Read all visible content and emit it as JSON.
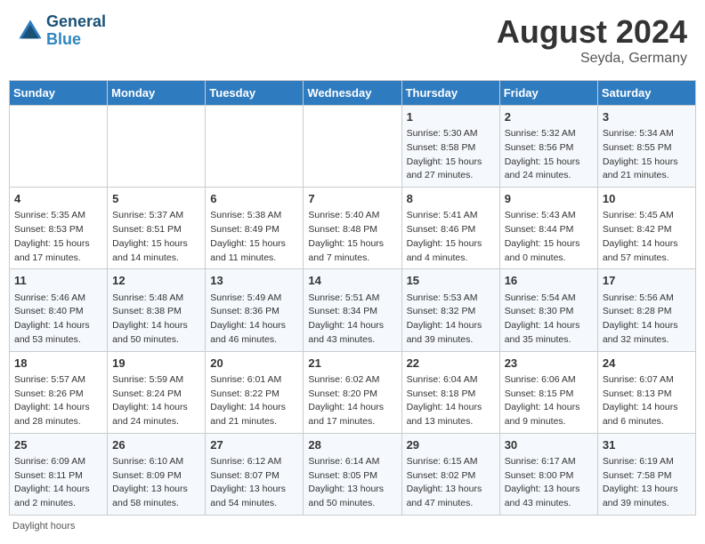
{
  "header": {
    "logo_line1": "General",
    "logo_line2": "Blue",
    "month_year": "August 2024",
    "location": "Seyda, Germany"
  },
  "days_of_week": [
    "Sunday",
    "Monday",
    "Tuesday",
    "Wednesday",
    "Thursday",
    "Friday",
    "Saturday"
  ],
  "weeks": [
    [
      {
        "day": "",
        "sunrise": "",
        "sunset": "",
        "daylight": ""
      },
      {
        "day": "",
        "sunrise": "",
        "sunset": "",
        "daylight": ""
      },
      {
        "day": "",
        "sunrise": "",
        "sunset": "",
        "daylight": ""
      },
      {
        "day": "",
        "sunrise": "",
        "sunset": "",
        "daylight": ""
      },
      {
        "day": "1",
        "sunrise": "Sunrise: 5:30 AM",
        "sunset": "Sunset: 8:58 PM",
        "daylight": "Daylight: 15 hours and 27 minutes."
      },
      {
        "day": "2",
        "sunrise": "Sunrise: 5:32 AM",
        "sunset": "Sunset: 8:56 PM",
        "daylight": "Daylight: 15 hours and 24 minutes."
      },
      {
        "day": "3",
        "sunrise": "Sunrise: 5:34 AM",
        "sunset": "Sunset: 8:55 PM",
        "daylight": "Daylight: 15 hours and 21 minutes."
      }
    ],
    [
      {
        "day": "4",
        "sunrise": "Sunrise: 5:35 AM",
        "sunset": "Sunset: 8:53 PM",
        "daylight": "Daylight: 15 hours and 17 minutes."
      },
      {
        "day": "5",
        "sunrise": "Sunrise: 5:37 AM",
        "sunset": "Sunset: 8:51 PM",
        "daylight": "Daylight: 15 hours and 14 minutes."
      },
      {
        "day": "6",
        "sunrise": "Sunrise: 5:38 AM",
        "sunset": "Sunset: 8:49 PM",
        "daylight": "Daylight: 15 hours and 11 minutes."
      },
      {
        "day": "7",
        "sunrise": "Sunrise: 5:40 AM",
        "sunset": "Sunset: 8:48 PM",
        "daylight": "Daylight: 15 hours and 7 minutes."
      },
      {
        "day": "8",
        "sunrise": "Sunrise: 5:41 AM",
        "sunset": "Sunset: 8:46 PM",
        "daylight": "Daylight: 15 hours and 4 minutes."
      },
      {
        "day": "9",
        "sunrise": "Sunrise: 5:43 AM",
        "sunset": "Sunset: 8:44 PM",
        "daylight": "Daylight: 15 hours and 0 minutes."
      },
      {
        "day": "10",
        "sunrise": "Sunrise: 5:45 AM",
        "sunset": "Sunset: 8:42 PM",
        "daylight": "Daylight: 14 hours and 57 minutes."
      }
    ],
    [
      {
        "day": "11",
        "sunrise": "Sunrise: 5:46 AM",
        "sunset": "Sunset: 8:40 PM",
        "daylight": "Daylight: 14 hours and 53 minutes."
      },
      {
        "day": "12",
        "sunrise": "Sunrise: 5:48 AM",
        "sunset": "Sunset: 8:38 PM",
        "daylight": "Daylight: 14 hours and 50 minutes."
      },
      {
        "day": "13",
        "sunrise": "Sunrise: 5:49 AM",
        "sunset": "Sunset: 8:36 PM",
        "daylight": "Daylight: 14 hours and 46 minutes."
      },
      {
        "day": "14",
        "sunrise": "Sunrise: 5:51 AM",
        "sunset": "Sunset: 8:34 PM",
        "daylight": "Daylight: 14 hours and 43 minutes."
      },
      {
        "day": "15",
        "sunrise": "Sunrise: 5:53 AM",
        "sunset": "Sunset: 8:32 PM",
        "daylight": "Daylight: 14 hours and 39 minutes."
      },
      {
        "day": "16",
        "sunrise": "Sunrise: 5:54 AM",
        "sunset": "Sunset: 8:30 PM",
        "daylight": "Daylight: 14 hours and 35 minutes."
      },
      {
        "day": "17",
        "sunrise": "Sunrise: 5:56 AM",
        "sunset": "Sunset: 8:28 PM",
        "daylight": "Daylight: 14 hours and 32 minutes."
      }
    ],
    [
      {
        "day": "18",
        "sunrise": "Sunrise: 5:57 AM",
        "sunset": "Sunset: 8:26 PM",
        "daylight": "Daylight: 14 hours and 28 minutes."
      },
      {
        "day": "19",
        "sunrise": "Sunrise: 5:59 AM",
        "sunset": "Sunset: 8:24 PM",
        "daylight": "Daylight: 14 hours and 24 minutes."
      },
      {
        "day": "20",
        "sunrise": "Sunrise: 6:01 AM",
        "sunset": "Sunset: 8:22 PM",
        "daylight": "Daylight: 14 hours and 21 minutes."
      },
      {
        "day": "21",
        "sunrise": "Sunrise: 6:02 AM",
        "sunset": "Sunset: 8:20 PM",
        "daylight": "Daylight: 14 hours and 17 minutes."
      },
      {
        "day": "22",
        "sunrise": "Sunrise: 6:04 AM",
        "sunset": "Sunset: 8:18 PM",
        "daylight": "Daylight: 14 hours and 13 minutes."
      },
      {
        "day": "23",
        "sunrise": "Sunrise: 6:06 AM",
        "sunset": "Sunset: 8:15 PM",
        "daylight": "Daylight: 14 hours and 9 minutes."
      },
      {
        "day": "24",
        "sunrise": "Sunrise: 6:07 AM",
        "sunset": "Sunset: 8:13 PM",
        "daylight": "Daylight: 14 hours and 6 minutes."
      }
    ],
    [
      {
        "day": "25",
        "sunrise": "Sunrise: 6:09 AM",
        "sunset": "Sunset: 8:11 PM",
        "daylight": "Daylight: 14 hours and 2 minutes."
      },
      {
        "day": "26",
        "sunrise": "Sunrise: 6:10 AM",
        "sunset": "Sunset: 8:09 PM",
        "daylight": "Daylight: 13 hours and 58 minutes."
      },
      {
        "day": "27",
        "sunrise": "Sunrise: 6:12 AM",
        "sunset": "Sunset: 8:07 PM",
        "daylight": "Daylight: 13 hours and 54 minutes."
      },
      {
        "day": "28",
        "sunrise": "Sunrise: 6:14 AM",
        "sunset": "Sunset: 8:05 PM",
        "daylight": "Daylight: 13 hours and 50 minutes."
      },
      {
        "day": "29",
        "sunrise": "Sunrise: 6:15 AM",
        "sunset": "Sunset: 8:02 PM",
        "daylight": "Daylight: 13 hours and 47 minutes."
      },
      {
        "day": "30",
        "sunrise": "Sunrise: 6:17 AM",
        "sunset": "Sunset: 8:00 PM",
        "daylight": "Daylight: 13 hours and 43 minutes."
      },
      {
        "day": "31",
        "sunrise": "Sunrise: 6:19 AM",
        "sunset": "Sunset: 7:58 PM",
        "daylight": "Daylight: 13 hours and 39 minutes."
      }
    ]
  ],
  "footer": {
    "note": "Daylight hours"
  }
}
